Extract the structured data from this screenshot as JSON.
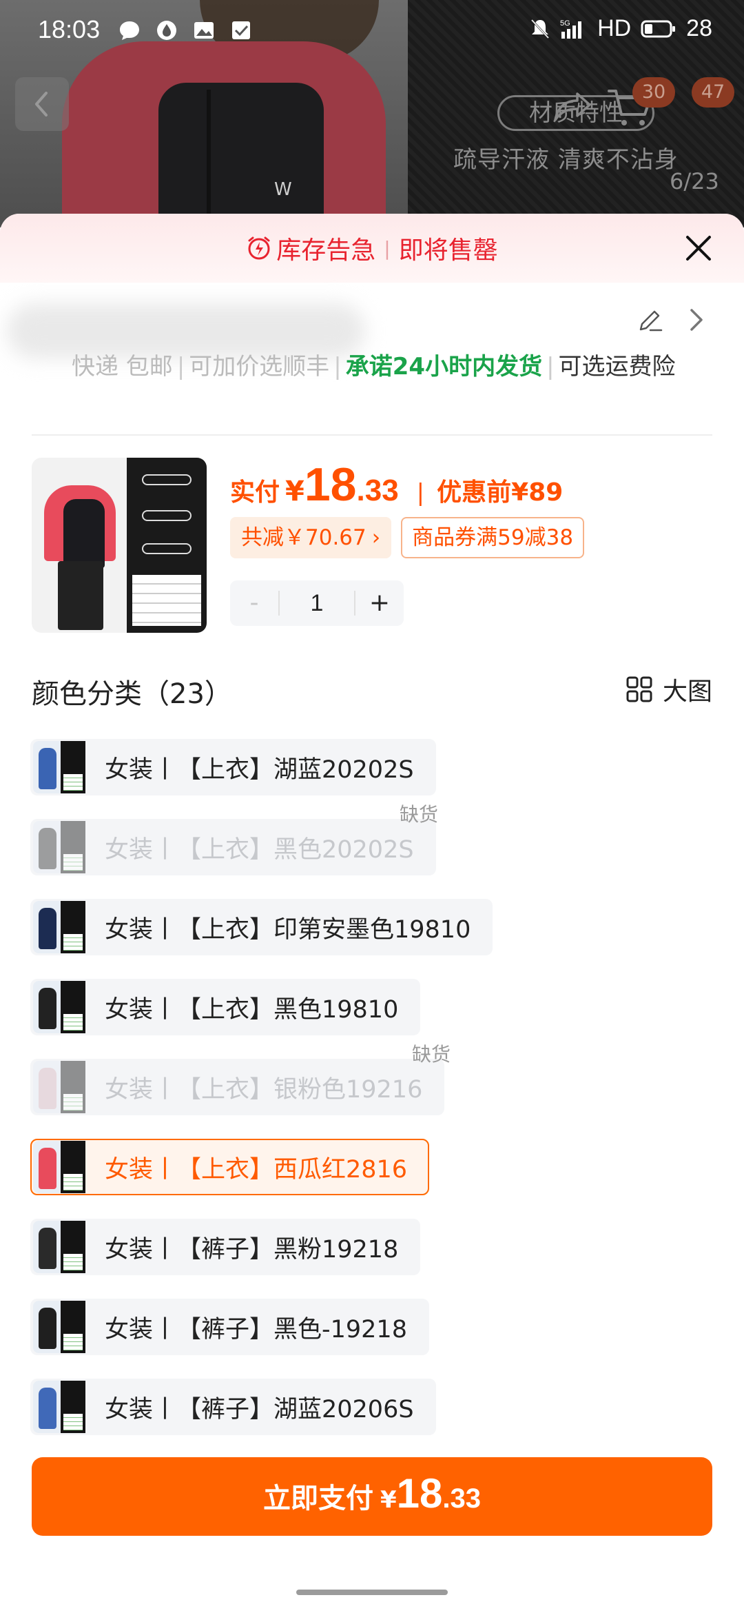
{
  "status_bar": {
    "time": "18:03",
    "network": "5G",
    "hd": "HD",
    "battery": "28"
  },
  "background": {
    "feature_tag": "材质特性",
    "feature_desc": "疏导汗液 清爽不沾身",
    "image_counter": "6/23",
    "badge_share": "30",
    "badge_cart": "47"
  },
  "banner": {
    "alert": "库存告急",
    "separator": "|",
    "soon": "即将售罄"
  },
  "address": {
    "shipping_prefix": "快递 包邮",
    "sep1": "|",
    "upgrade": "可加价选顺丰",
    "sep2": "|",
    "promise": "承诺24小时内发货",
    "sep3": "|",
    "insurance": "可选运费险"
  },
  "price": {
    "label": "实付",
    "currency": "¥",
    "integer": "18",
    "decimal": ".33",
    "divider": "|",
    "before_label": "优惠前",
    "before_value": "¥89"
  },
  "promos": {
    "discount": "共减￥70.67",
    "discount_chevron": "›",
    "coupon": "商品券满59减38"
  },
  "stepper": {
    "minus": "-",
    "value": "1",
    "plus": "+"
  },
  "section": {
    "title": "颜色分类（23）",
    "big_image": "大图"
  },
  "variants": [
    {
      "label": "女装丨【上衣】湖蓝20202S",
      "state": "normal",
      "color": "#3a64b3"
    },
    {
      "label": "女装丨【上衣】黑色20202S",
      "state": "out_of_stock",
      "oos_text": "缺货",
      "color": "#333333"
    },
    {
      "label": "女装丨【上衣】印第安墨色19810",
      "state": "normal",
      "color": "#1c2c52"
    },
    {
      "label": "女装丨【上衣】黑色19810",
      "state": "normal",
      "color": "#222222"
    },
    {
      "label": "女装丨【上衣】银粉色19216",
      "state": "out_of_stock",
      "oos_text": "缺货",
      "color": "#d9b8c0"
    },
    {
      "label": "女装丨【上衣】西瓜红2816",
      "state": "selected",
      "color": "#e84b5c"
    },
    {
      "label": "女装丨【裤子】黑粉19218",
      "state": "normal",
      "color": "#2a2a2a"
    },
    {
      "label": "女装丨【裤子】黑色-19218",
      "state": "normal",
      "color": "#1f1f1f"
    },
    {
      "label": "女装丨【裤子】湖蓝20206S",
      "state": "normal",
      "color": "#4069b8"
    }
  ],
  "pay_button": {
    "label": "立即支付",
    "currency": "¥",
    "integer": "18",
    "decimal": ".33"
  },
  "colors": {
    "accent": "#ff6200",
    "alert_red": "#e8232f",
    "promise_green": "#1aa34a"
  },
  "icons": [
    "back-icon",
    "share-icon",
    "cart-icon",
    "alarm-icon",
    "close-icon",
    "edit-icon",
    "chevron-right-icon",
    "grid-icon"
  ]
}
